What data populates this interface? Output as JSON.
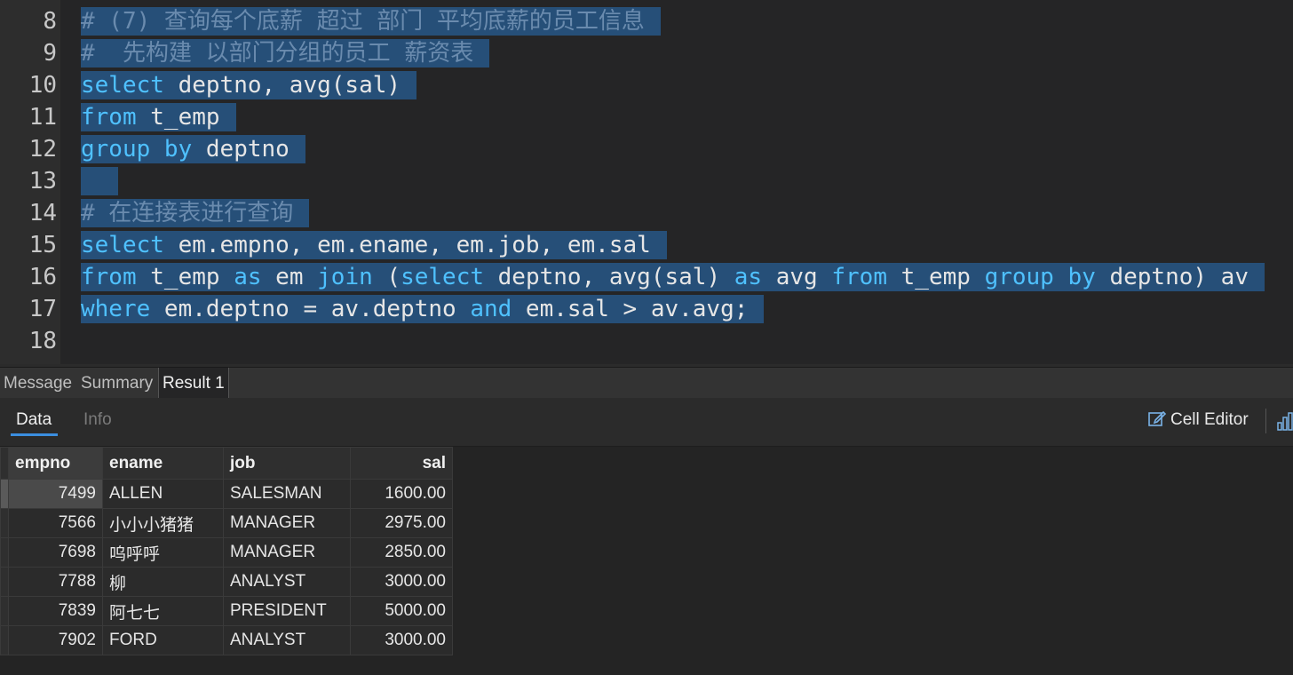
{
  "editor": {
    "lines": [
      {
        "num": "8",
        "parts": [
          {
            "t": "# (7) 查询每个底薪 超过 部门 平均底薪的员工信息",
            "c": "cm"
          }
        ]
      },
      {
        "num": "9",
        "parts": [
          {
            "t": "#  先构建 以部门分组的员工 薪资表",
            "c": "cm"
          }
        ]
      },
      {
        "num": "10",
        "parts": [
          {
            "t": "select",
            "c": "kw"
          },
          {
            "t": " deptno, avg(sal)",
            "c": ""
          }
        ]
      },
      {
        "num": "11",
        "parts": [
          {
            "t": "from",
            "c": "kw"
          },
          {
            "t": " t_emp",
            "c": ""
          }
        ]
      },
      {
        "num": "12",
        "parts": [
          {
            "t": "group by",
            "c": "kw"
          },
          {
            "t": " deptno",
            "c": ""
          }
        ]
      },
      {
        "num": "13",
        "parts": []
      },
      {
        "num": "14",
        "parts": [
          {
            "t": "# 在连接表进行查询",
            "c": "cm"
          }
        ]
      },
      {
        "num": "15",
        "parts": [
          {
            "t": "select",
            "c": "kw"
          },
          {
            "t": " em.empno, em.ename, em.job, em.sal",
            "c": ""
          }
        ]
      },
      {
        "num": "16",
        "parts": [
          {
            "t": "from",
            "c": "kw"
          },
          {
            "t": " t_emp ",
            "c": ""
          },
          {
            "t": "as",
            "c": "kw"
          },
          {
            "t": " em ",
            "c": ""
          },
          {
            "t": "join",
            "c": "kw"
          },
          {
            "t": " (",
            "c": ""
          },
          {
            "t": "select",
            "c": "kw"
          },
          {
            "t": " deptno, avg(sal) ",
            "c": ""
          },
          {
            "t": "as",
            "c": "kw"
          },
          {
            "t": " avg ",
            "c": ""
          },
          {
            "t": "from",
            "c": "kw"
          },
          {
            "t": " t_emp ",
            "c": ""
          },
          {
            "t": "group by",
            "c": "kw"
          },
          {
            "t": " deptno) av",
            "c": ""
          }
        ]
      },
      {
        "num": "17",
        "parts": [
          {
            "t": "where",
            "c": "kw"
          },
          {
            "t": " em.deptno = av.deptno ",
            "c": ""
          },
          {
            "t": "and",
            "c": "kw"
          },
          {
            "t": " em.sal > av.avg;",
            "c": ""
          }
        ]
      },
      {
        "num": "18",
        "parts": [],
        "unselected": true
      }
    ]
  },
  "tabs": {
    "message": "Message",
    "summary": "Summary",
    "result": "Result 1"
  },
  "subtabs": {
    "data": "Data",
    "info": "Info"
  },
  "toolbar": {
    "cell_editor": "Cell Editor"
  },
  "table": {
    "columns": [
      "empno",
      "ename",
      "job",
      "sal"
    ],
    "rows": [
      [
        "7499",
        "ALLEN",
        "SALESMAN",
        "1600.00"
      ],
      [
        "7566",
        "小小小猪猪",
        "MANAGER",
        "2975.00"
      ],
      [
        "7698",
        "呜呼呼",
        "MANAGER",
        "2850.00"
      ],
      [
        "7788",
        "柳",
        "ANALYST",
        "3000.00"
      ],
      [
        "7839",
        "阿七七",
        "PRESIDENT",
        "5000.00"
      ],
      [
        "7902",
        "FORD",
        "ANALYST",
        "3000.00"
      ]
    ]
  },
  "colors": {
    "selection": "#264f78",
    "keyword": "#4fc1ff",
    "comment": "#6a8bae",
    "accent": "#3b8ee0"
  }
}
